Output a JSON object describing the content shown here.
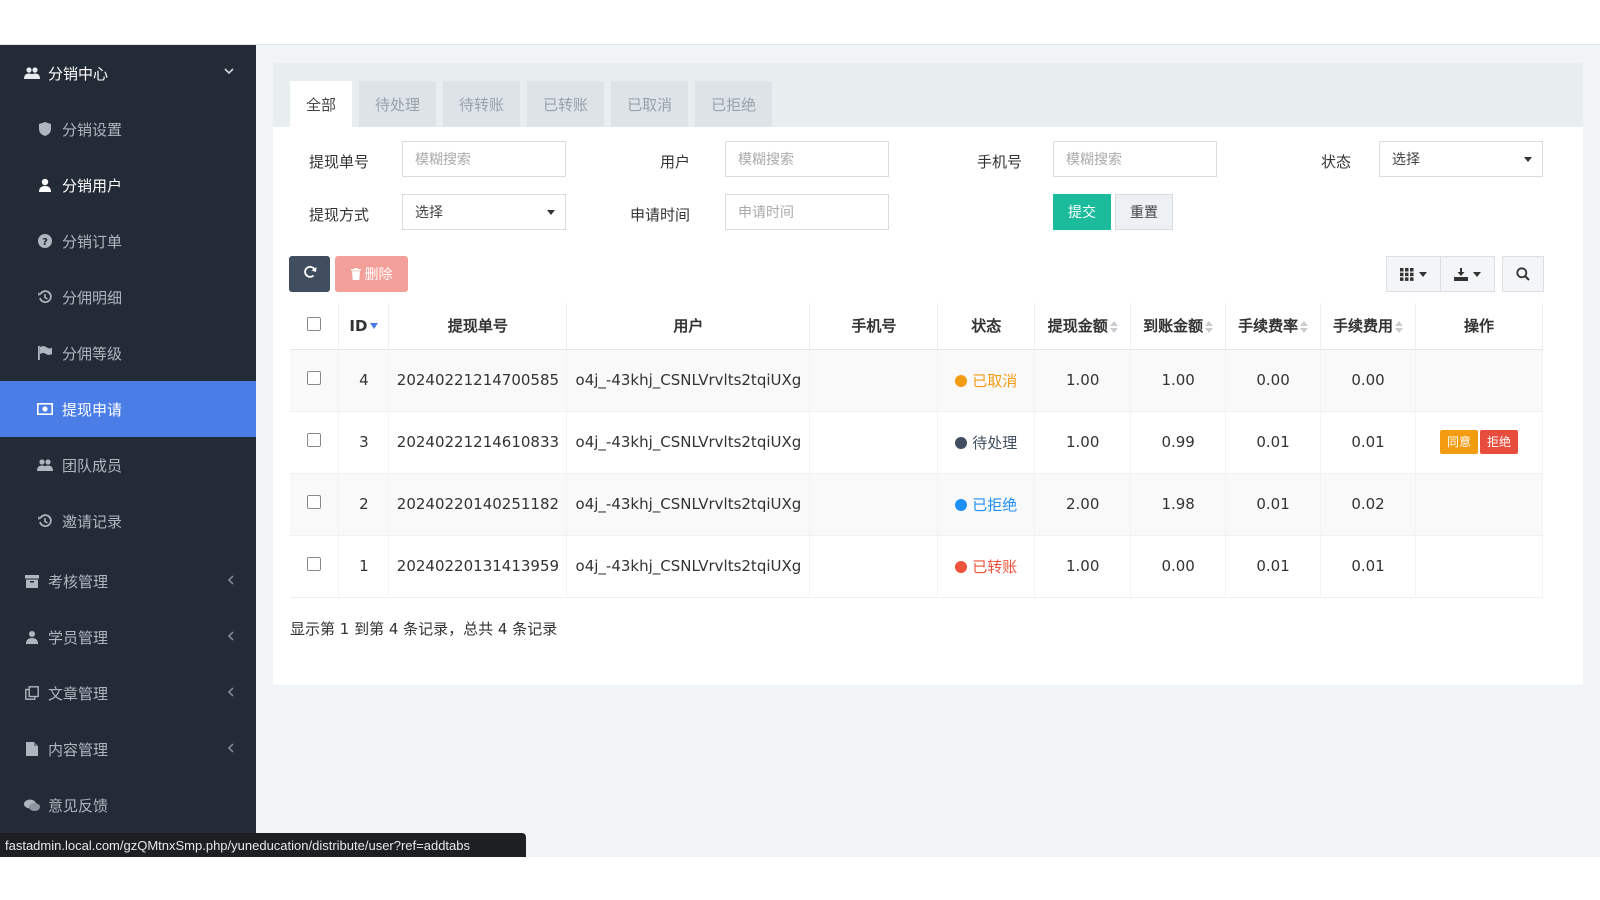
{
  "sidebar": {
    "group": {
      "label": "分销中心",
      "icon": "users-icon"
    },
    "items": [
      {
        "label": "分销设置",
        "icon": "shield-icon"
      },
      {
        "label": "分销用户",
        "icon": "user-icon"
      },
      {
        "label": "分销订单",
        "icon": "question-circle-icon"
      },
      {
        "label": "分佣明细",
        "icon": "history-icon"
      },
      {
        "label": "分佣等级",
        "icon": "flag-icon"
      },
      {
        "label": "提现申请",
        "icon": "money-icon"
      },
      {
        "label": "团队成员",
        "icon": "users-icon"
      },
      {
        "label": "邀请记录",
        "icon": "history-icon"
      }
    ],
    "sections": [
      {
        "label": "考核管理",
        "icon": "archive-icon"
      },
      {
        "label": "学员管理",
        "icon": "student-icon"
      },
      {
        "label": "文章管理",
        "icon": "copy-icon"
      },
      {
        "label": "内容管理",
        "icon": "file-icon"
      },
      {
        "label": "意见反馈",
        "icon": "comments-icon"
      }
    ]
  },
  "tabs": [
    "全部",
    "待处理",
    "待转账",
    "已转账",
    "已取消",
    "已拒绝"
  ],
  "filters": {
    "order_no_label": "提现单号",
    "order_no_placeholder": "模糊搜索",
    "user_label": "用户",
    "user_placeholder": "模糊搜索",
    "phone_label": "手机号",
    "phone_placeholder": "模糊搜索",
    "status_label": "状态",
    "status_value": "选择",
    "method_label": "提现方式",
    "method_value": "选择",
    "time_label": "申请时间",
    "time_placeholder": "申请时间",
    "submit": "提交",
    "reset": "重置"
  },
  "toolbar": {
    "delete": "删除"
  },
  "table": {
    "headers": [
      "ID",
      "提现单号",
      "用户",
      "手机号",
      "状态",
      "提现金额",
      "到账金额",
      "手续费率",
      "手续费用",
      "操作"
    ],
    "rows": [
      {
        "id": "4",
        "order_no": "20240221214700585",
        "user": "o4j_-43khj_CSNLVrvlts2tqiUXg",
        "phone": "",
        "status": "已取消",
        "status_color": "#f39c12",
        "amount": "1.00",
        "received": "1.00",
        "fee_rate": "0.00",
        "fee": "0.00"
      },
      {
        "id": "3",
        "order_no": "20240221214610833",
        "user": "o4j_-43khj_CSNLVrvlts2tqiUXg",
        "phone": "",
        "status": "待处理",
        "status_color": "#3f4d5e",
        "amount": "1.00",
        "received": "0.99",
        "fee_rate": "0.01",
        "fee": "0.01",
        "actions": [
          "同意",
          "拒绝"
        ]
      },
      {
        "id": "2",
        "order_no": "20240220140251182",
        "user": "o4j_-43khj_CSNLVrvlts2tqiUXg",
        "phone": "",
        "status": "已拒绝",
        "status_color": "#1e8ff5",
        "amount": "2.00",
        "received": "1.98",
        "fee_rate": "0.01",
        "fee": "0.02"
      },
      {
        "id": "1",
        "order_no": "20240220131413959",
        "user": "o4j_-43khj_CSNLVrvlts2tqiUXg",
        "phone": "",
        "status": "已转账",
        "status_color": "#f0533d",
        "amount": "1.00",
        "received": "0.00",
        "fee_rate": "0.01",
        "fee": "0.01"
      }
    ]
  },
  "pagination_text": "显示第 1 到第 4 条记录，总共 4 条记录",
  "status_bar_url": "fastadmin.local.com/gzQMtnxSmp.php/yuneducation/distribute/user?ref=addtabs",
  "colors": {
    "sidebar_bg": "#232b36",
    "active_item": "#4a7ee6",
    "submit": "#1bbc9b",
    "approve": "#f39c12",
    "reject": "#e74c3c"
  }
}
